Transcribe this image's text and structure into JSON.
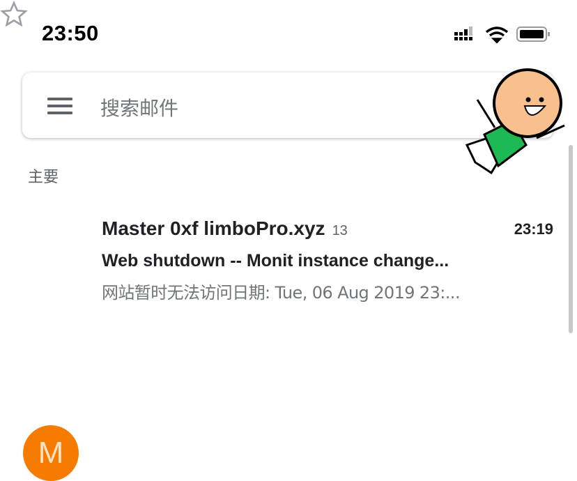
{
  "status_bar": {
    "time": "23:50"
  },
  "search": {
    "placeholder": "搜索邮件"
  },
  "section_label": "主要",
  "email": {
    "avatar_letter": "M",
    "avatar_color": "#f57c00",
    "sender": "Master 0xf limboPro.xyz",
    "count": "13",
    "time": "23:19",
    "subject": "Web shutdown --  Monit instance change...",
    "snippet": "网站暂时无法访问日期: Tue, 06 Aug 2019 23:..."
  }
}
